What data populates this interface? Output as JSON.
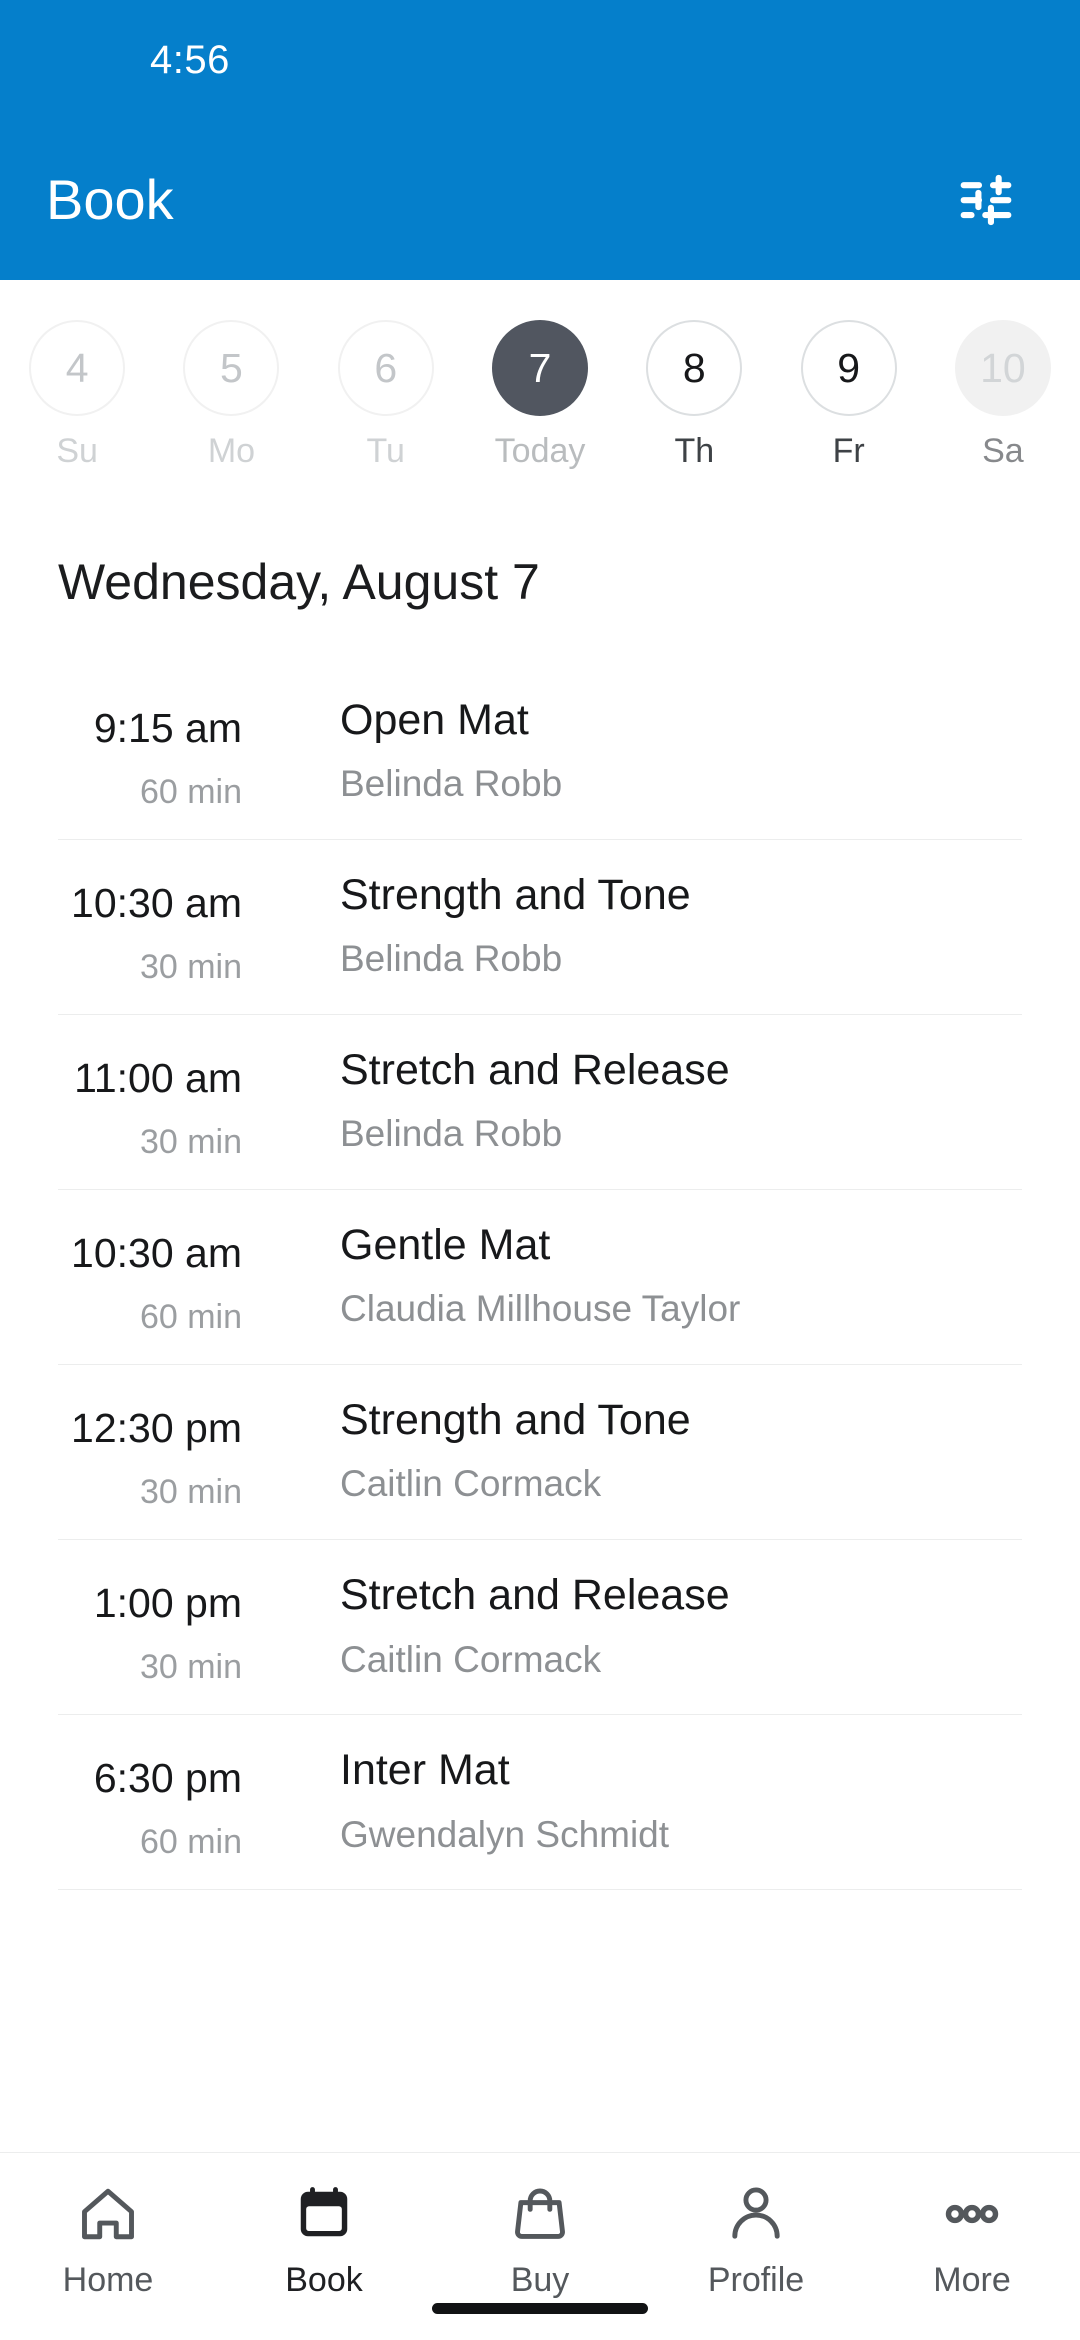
{
  "theme": {
    "accent": "#057FCB",
    "selected_day_bg": "#515660",
    "text_primary": "#17181a",
    "text_secondary": "#8d9093",
    "divider": "#eceded"
  },
  "status_bar": {
    "clock": "4:56"
  },
  "app_bar": {
    "title": "Book",
    "filter_icon": "tune-icon"
  },
  "date_strip": {
    "days": [
      {
        "num": "4",
        "label": "Su",
        "state": "disabled"
      },
      {
        "num": "5",
        "label": "Mo",
        "state": "disabled"
      },
      {
        "num": "6",
        "label": "Tu",
        "state": "disabled"
      },
      {
        "num": "7",
        "label": "Today",
        "state": "selected"
      },
      {
        "num": "8",
        "label": "Th",
        "state": "available"
      },
      {
        "num": "9",
        "label": "Fr",
        "state": "available"
      },
      {
        "num": "10",
        "label": "Sa",
        "state": "filled"
      }
    ]
  },
  "schedule": {
    "date_heading": "Wednesday, August 7",
    "classes": [
      {
        "time": "9:15 am",
        "duration": "60 min",
        "name": "Open Mat",
        "instructor": "Belinda Robb"
      },
      {
        "time": "10:30 am",
        "duration": "30 min",
        "name": "Strength and Tone",
        "instructor": "Belinda Robb"
      },
      {
        "time": "11:00 am",
        "duration": "30 min",
        "name": "Stretch and Release",
        "instructor": "Belinda Robb"
      },
      {
        "time": "10:30 am",
        "duration": "60 min",
        "name": "Gentle Mat",
        "instructor": "Claudia Millhouse Taylor"
      },
      {
        "time": "12:30 pm",
        "duration": "30 min",
        "name": "Strength and Tone",
        "instructor": "Caitlin Cormack"
      },
      {
        "time": "1:00 pm",
        "duration": "30 min",
        "name": "Stretch and Release",
        "instructor": "Caitlin Cormack"
      },
      {
        "time": "6:30 pm",
        "duration": "60 min",
        "name": "Inter Mat",
        "instructor": "Gwendalyn Schmidt"
      }
    ]
  },
  "bottom_nav": {
    "items": [
      {
        "label": "Home",
        "icon": "home-icon",
        "active": false
      },
      {
        "label": "Book",
        "icon": "calendar-icon",
        "active": true
      },
      {
        "label": "Buy",
        "icon": "bag-icon",
        "active": false
      },
      {
        "label": "Profile",
        "icon": "person-icon",
        "active": false
      },
      {
        "label": "More",
        "icon": "dots-icon",
        "active": false
      }
    ]
  }
}
